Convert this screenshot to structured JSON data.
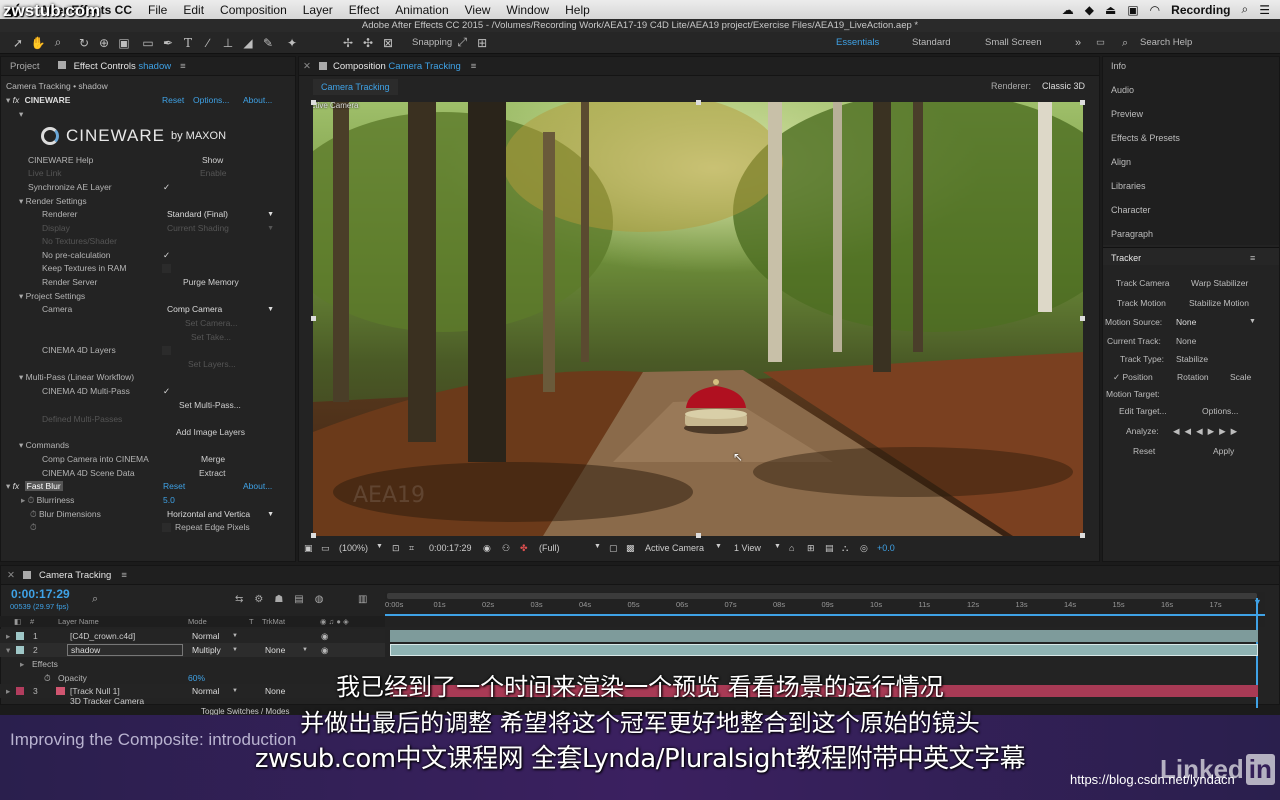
{
  "menubar": {
    "app": "After Effects CC",
    "items": [
      "File",
      "Edit",
      "Composition",
      "Layer",
      "Effect",
      "Animation",
      "View",
      "Window",
      "Help"
    ],
    "recording": "Recording"
  },
  "title": "Adobe After Effects CC 2015 - /Volumes/Recording Work/AEA17-19 C4D Lite/AEA19 project/Exercise Files/AEA19_LiveAction.aep *",
  "toolbar": {
    "snapping": "Snapping",
    "workspaces": [
      "Essentials",
      "Standard",
      "Small Screen"
    ],
    "search_help": "Search Help"
  },
  "effect_panel": {
    "tab_project": "Project",
    "tab_effect": "Effect Controls",
    "tab_layer": "shadow",
    "breadcrumb": "Camera Tracking • shadow",
    "cineware": {
      "name": "CINEWARE",
      "reset": "Reset",
      "options": "Options...",
      "about": "About...",
      "logo": "CINEWARE",
      "logo_by": "by MAXON",
      "help_label": "CINEWARE Help",
      "help_btn": "Show",
      "live_link": "Live Link",
      "enable": "Enable",
      "sync_label": "Synchronize AE Layer",
      "render_settings": "Render Settings",
      "renderer_label": "Renderer",
      "renderer_value": "Standard (Final)",
      "display_label": "Display",
      "display_value": "Current Shading",
      "no_textures": "No Textures/Shader",
      "no_precalc": "No pre-calculation",
      "keep_textures": "Keep Textures in RAM",
      "render_server": "Render Server",
      "purge_memory": "Purge Memory",
      "project_settings": "Project Settings",
      "camera_label": "Camera",
      "camera_value": "Comp Camera",
      "set_camera": "Set Camera...",
      "set_take": "Set Take...",
      "c4d_layers": "CINEMA 4D Layers",
      "set_layers": "Set Layers...",
      "multipass": "Multi-Pass (Linear Workflow)",
      "c4d_multipass": "CINEMA 4D Multi-Pass",
      "set_multipass": "Set Multi-Pass...",
      "defined_multipass": "Defined Multi-Passes",
      "add_image_layers": "Add Image Layers",
      "commands": "Commands",
      "comp_camera_into": "Comp Camera into CINEMA",
      "merge": "Merge",
      "scene_data": "CINEMA 4D Scene Data",
      "extract": "Extract"
    },
    "fast_blur": {
      "name": "Fast Blur",
      "reset": "Reset",
      "about": "About...",
      "blurriness_label": "Blurriness",
      "blurriness_value": "5.0",
      "dims_label": "Blur Dimensions",
      "dims_value": "Horizontal and Vertica",
      "repeat_edge": "Repeat Edge Pixels"
    }
  },
  "composition": {
    "tab_label": "Composition",
    "tab_name": "Camera Tracking",
    "subtab": "Camera Tracking",
    "renderer_label": "Renderer:",
    "renderer_value": "Classic 3D",
    "active_camera_overlay": "Active Camera",
    "footer": {
      "zoom": "(100%)",
      "timecode": "0:00:17:29",
      "resolution": "(Full)",
      "view": "Active Camera",
      "views": "1 View",
      "exposure": "+0.0"
    }
  },
  "right_panel": {
    "items": [
      "Info",
      "Audio",
      "Preview",
      "Effects & Presets",
      "Align",
      "Libraries",
      "Character",
      "Paragraph"
    ],
    "tracker": {
      "title": "Tracker",
      "track_camera": "Track Camera",
      "warp_stabilizer": "Warp Stabilizer",
      "track_motion": "Track Motion",
      "stabilize_motion": "Stabilize Motion",
      "motion_source_label": "Motion Source:",
      "motion_source_value": "None",
      "current_track_label": "Current Track:",
      "current_track_value": "None",
      "track_type_label": "Track Type:",
      "track_type_value": "Stabilize",
      "position": "Position",
      "rotation": "Rotation",
      "scale": "Scale",
      "motion_target": "Motion Target:",
      "edit_target": "Edit Target...",
      "options": "Options...",
      "analyze": "Analyze:",
      "reset": "Reset",
      "apply": "Apply"
    }
  },
  "timeline": {
    "tab": "Camera Tracking",
    "timecode": "0:00:17:29",
    "frames": "00539 (29.97 fps)",
    "headers": {
      "layer_name": "Layer Name",
      "mode": "Mode",
      "t": "T",
      "trkmat": "TrkMat"
    },
    "ruler": [
      "0:00s",
      "01s",
      "02s",
      "03s",
      "04s",
      "05s",
      "06s",
      "07s",
      "08s",
      "09s",
      "10s",
      "11s",
      "12s",
      "13s",
      "14s",
      "15s",
      "16s",
      "17s"
    ],
    "layers": [
      {
        "num": "1",
        "name": "[C4D_crown.c4d]",
        "mode": "Normal",
        "trkmat": ""
      },
      {
        "num": "2",
        "name": "shadow",
        "mode": "Multiply",
        "trkmat": "None"
      },
      {
        "num": "3",
        "name": "[Track Null 1]",
        "mode": "Normal",
        "trkmat": "None"
      },
      {
        "num": "4",
        "name": "3D Tracker Camera",
        "mode": "",
        "trkmat": ""
      }
    ],
    "effects_label": "Effects",
    "opacity_label": "Opacity",
    "opacity_value": "60%",
    "toggle": "Toggle Switches / Modes"
  },
  "overlay": {
    "course_title": "Improving the Composite: introduction",
    "subtitle_1": "我已经到了一个时间来渲染一个预览  看看场景的运行情况",
    "subtitle_2": "并做出最后的调整  希望将这个冠军更好地整合到这个原始的镜头",
    "subtitle_3": "zwsub.com中文课程网 全套Lynda/Pluralsight教程附带中英文字幕",
    "watermark_tl": "zwstub.com",
    "linkedin": "Linked",
    "linkedin_in": "in",
    "csdn": "https://blog.csdn.net/lyndacn"
  },
  "colors": {
    "accent": "#3fa2e6",
    "purple": "#2a1a4a",
    "track_null": "#a83a55"
  }
}
